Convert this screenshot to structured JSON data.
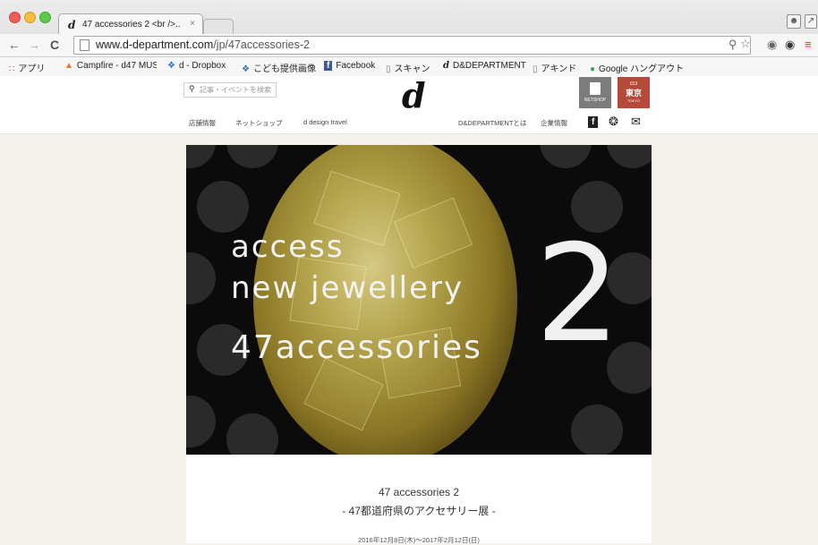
{
  "tab": {
    "favicon": "d",
    "title": "47 accessories 2 <br />...",
    "close": "×"
  },
  "address_bar": {
    "domain": "www.d-department.com",
    "path": "/jp/47accessories-2"
  },
  "bookmarks": [
    {
      "icon": "apps-icon",
      "label": "アプリ"
    },
    {
      "icon": "campfire-icon",
      "label": "Campfire - d47 MUS"
    },
    {
      "icon": "dropbox-icon",
      "label": "d - Dropbox"
    },
    {
      "icon": "dropbox-icon",
      "label": "こども提供画像"
    },
    {
      "icon": "facebook-icon",
      "label": "Facebook"
    },
    {
      "icon": "page-icon",
      "label": "スキャン"
    },
    {
      "icon": "d-logo-icon",
      "label": "D&DEPARTMENT"
    },
    {
      "icon": "page-icon",
      "label": "アキンド"
    },
    {
      "icon": "hangouts-icon",
      "label": "Google ハングアウト"
    }
  ],
  "site": {
    "search_placeholder": "記事・イベントを検索",
    "logo": "d",
    "netshop_label": "NETSHOP",
    "tokyo_label": "東京",
    "tokyo_code": "013",
    "tokyo_sub": "TOKYO",
    "nav_left": [
      "店舗情報",
      "ネットショップ",
      "d design travel"
    ],
    "nav_right": [
      "D&DEPARTMENTとは",
      "企業情報"
    ]
  },
  "hero": {
    "line1": "access",
    "line2": "new jewellery",
    "line3": "47accessories",
    "number": "2"
  },
  "event": {
    "title": "47 accessories 2",
    "subtitle": "- 47都道府県のアクセサリー展 -",
    "date": "2016年12月8日(木)〜2017年2月12日(日)"
  },
  "colors": {
    "page_bg": "#f3f1ea",
    "hero_bg": "#0b0b0b",
    "tokyo_red": "#b5493a",
    "gem_gold": "#b8a74a"
  }
}
